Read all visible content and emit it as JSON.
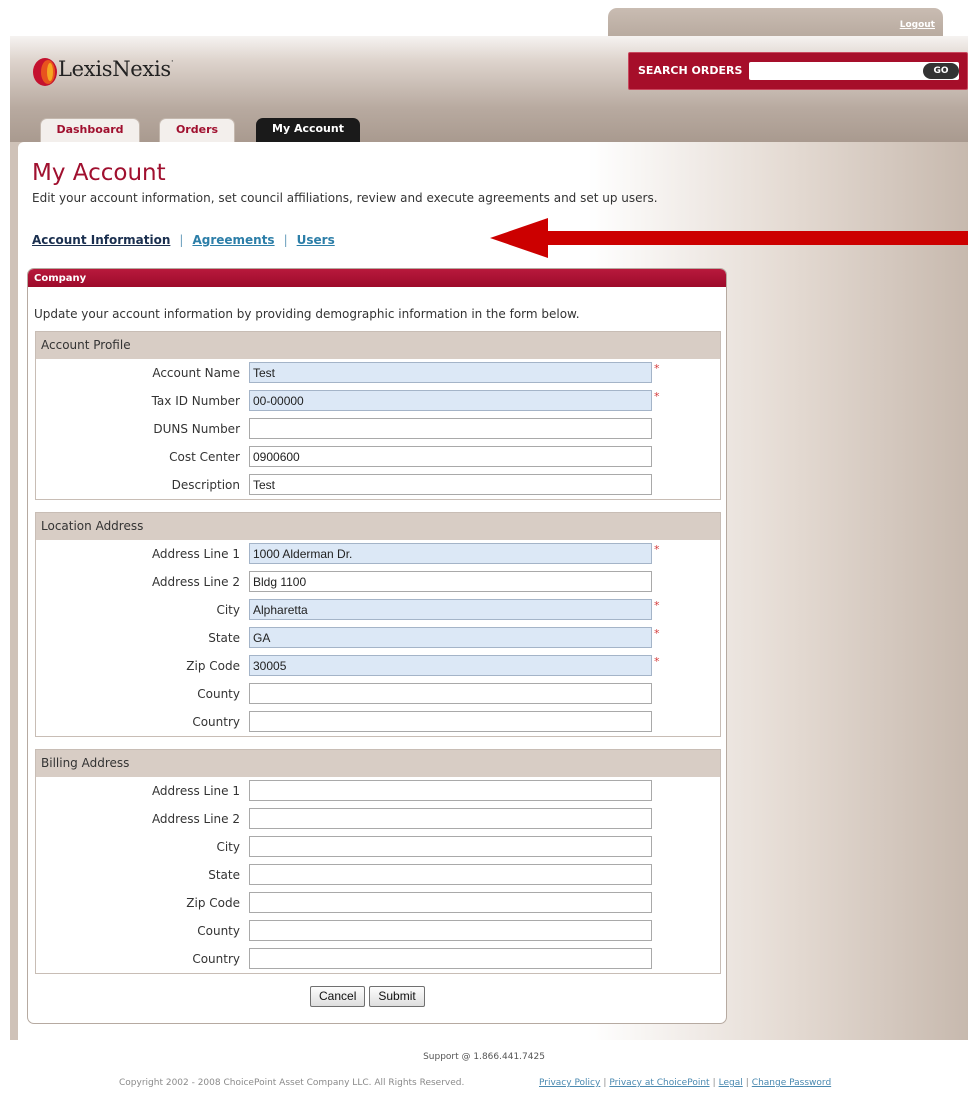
{
  "header": {
    "logout_label": "Logout",
    "logo_text": "LexisNexis",
    "logo_mark": "·",
    "search": {
      "label": "SEARCH ORDERS",
      "value": "",
      "go_label": "GO"
    }
  },
  "nav": {
    "tabs": [
      {
        "label": "Dashboard",
        "active": false
      },
      {
        "label": "Orders",
        "active": false
      },
      {
        "label": "My Account",
        "active": true
      }
    ]
  },
  "page": {
    "title": "My Account",
    "description": "Edit your account information, set council affiliations, review and execute agreements and set up users."
  },
  "subnav": {
    "items": [
      {
        "label": "Account Information",
        "current": true
      },
      {
        "label": "Agreements",
        "current": false
      },
      {
        "label": "Users",
        "current": false
      }
    ],
    "separator": "|"
  },
  "panel": {
    "title": "Company",
    "intro": "Update your account information by providing demographic information in the form below.",
    "required_marker": "*",
    "sections": [
      {
        "title": "Account Profile",
        "fields": [
          {
            "label": "Account Name",
            "value": "Test",
            "required": true
          },
          {
            "label": "Tax ID Number",
            "value": "00-00000",
            "required": true
          },
          {
            "label": "DUNS Number",
            "value": "",
            "required": false
          },
          {
            "label": "Cost Center",
            "value": "0900600",
            "required": false
          },
          {
            "label": "Description",
            "value": "Test",
            "required": false
          }
        ]
      },
      {
        "title": "Location Address",
        "fields": [
          {
            "label": "Address Line 1",
            "value": "1000 Alderman Dr.",
            "required": true
          },
          {
            "label": "Address Line 2",
            "value": "Bldg 1100",
            "required": false
          },
          {
            "label": "City",
            "value": "Alpharetta",
            "required": true
          },
          {
            "label": "State",
            "value": "GA",
            "required": true
          },
          {
            "label": "Zip Code",
            "value": "30005",
            "required": true
          },
          {
            "label": "County",
            "value": "",
            "required": false
          },
          {
            "label": "Country",
            "value": "",
            "required": false
          }
        ]
      },
      {
        "title": "Billing Address",
        "fields": [
          {
            "label": "Address Line 1",
            "value": "",
            "required": false
          },
          {
            "label": "Address Line 2",
            "value": "",
            "required": false
          },
          {
            "label": "City",
            "value": "",
            "required": false
          },
          {
            "label": "State",
            "value": "",
            "required": false
          },
          {
            "label": "Zip Code",
            "value": "",
            "required": false
          },
          {
            "label": "County",
            "value": "",
            "required": false
          },
          {
            "label": "Country",
            "value": "",
            "required": false
          }
        ]
      }
    ],
    "cancel_label": "Cancel",
    "submit_label": "Submit"
  },
  "footer": {
    "support": "Support @ 1.866.441.7425",
    "copyright": "Copyright 2002 - 2008 ChoicePoint Asset Company LLC. All Rights Reserved.",
    "links": [
      "Privacy Policy",
      "Privacy at ChoicePoint",
      "Legal",
      "Change Password"
    ],
    "link_separator": "|"
  },
  "colors": {
    "brand_red": "#a0102f",
    "link_blue": "#2c7ea8",
    "required_field_bg": "#dce8f6",
    "annotation_arrow": "#cc0000"
  },
  "icons": [
    "lexisnexis-swoosh-icon",
    "red-arrow-icon"
  ]
}
